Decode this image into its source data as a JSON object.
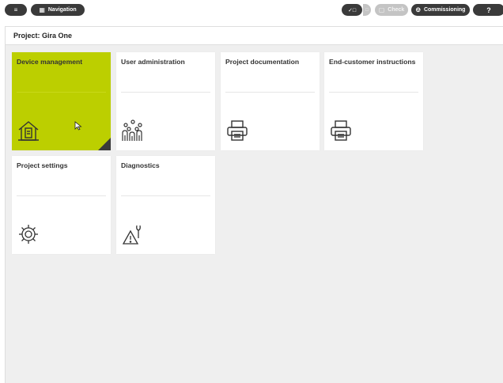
{
  "toolbar": {
    "menu_icon": "list-icon",
    "navigation_label": "Navigation",
    "navigation_icon": "grid-icon",
    "check_label": "Check",
    "commissioning_label": "Commissioning",
    "help_label": "?"
  },
  "project": {
    "title": "Project: Gira One"
  },
  "tiles": [
    {
      "label": "Device management",
      "icon": "house-icon",
      "active": true
    },
    {
      "label": "User administration",
      "icon": "users-icon",
      "active": false
    },
    {
      "label": "Project documentation",
      "icon": "printer-icon",
      "active": false
    },
    {
      "label": "End-customer instructions",
      "icon": "printer-icon",
      "active": false
    },
    {
      "label": "Project settings",
      "icon": "gear-icon",
      "active": false
    },
    {
      "label": "Diagnostics",
      "icon": "warning-wrench-icon",
      "active": false
    }
  ],
  "colors": {
    "accent": "#bccf00",
    "toolbar_pill": "#3a3a3a",
    "background": "#efefef"
  }
}
